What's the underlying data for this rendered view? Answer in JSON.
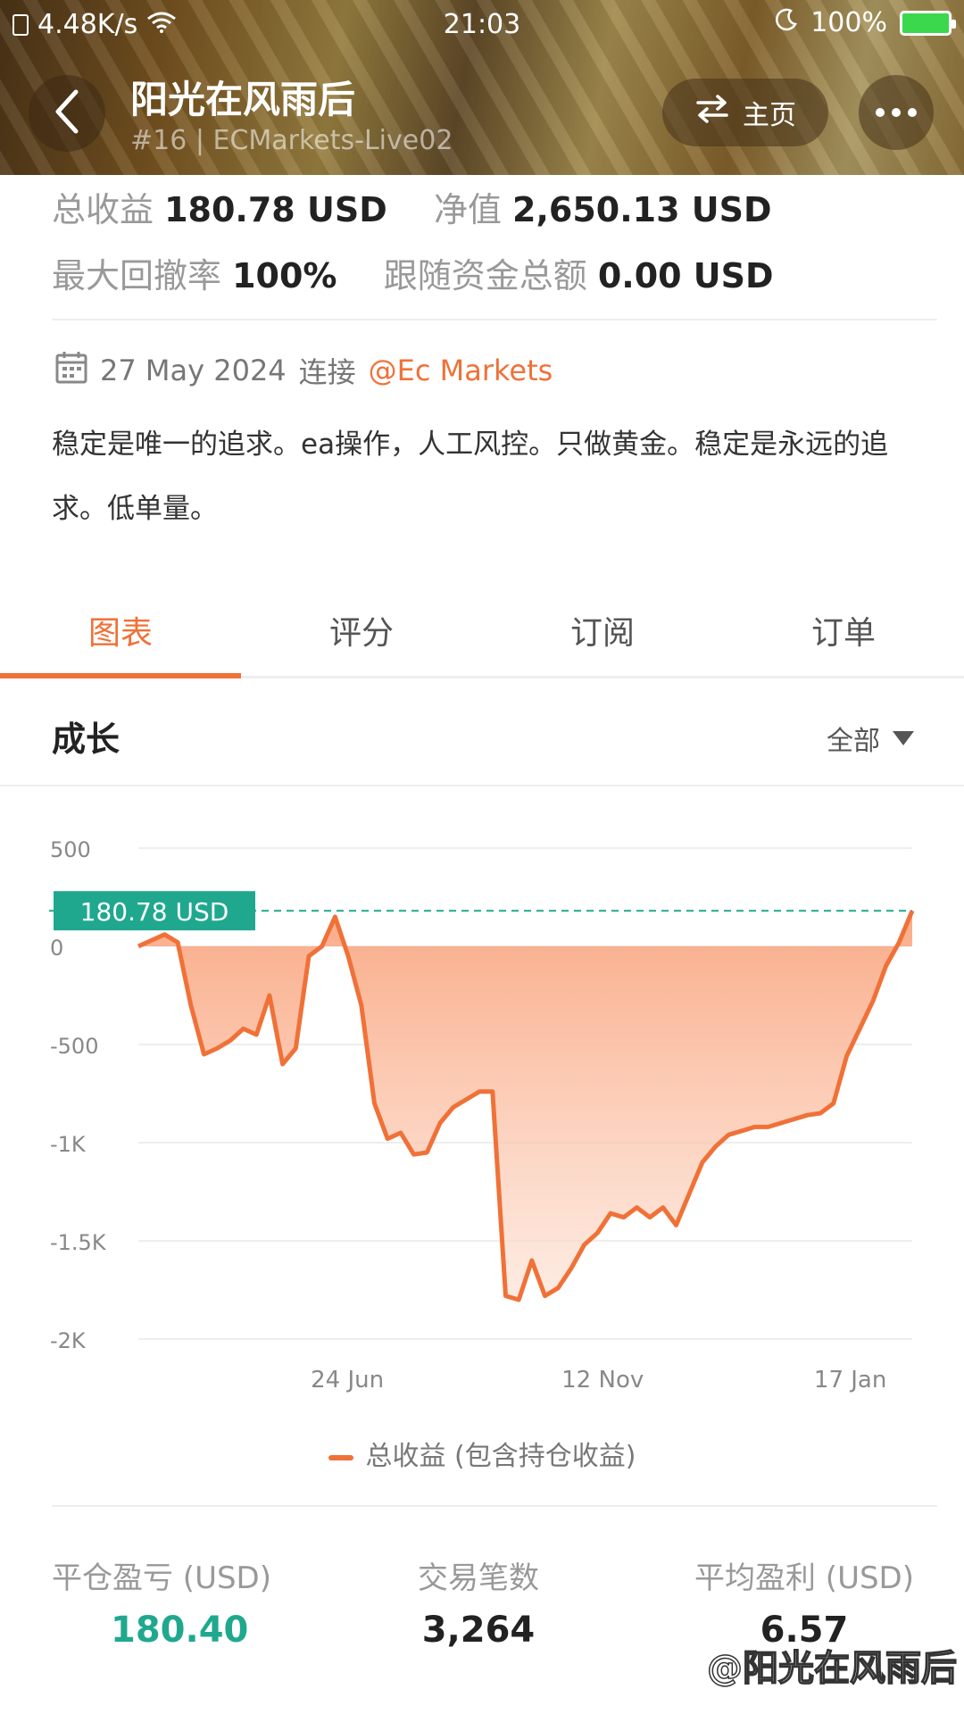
{
  "status": {
    "net_speed": "4.48K/s",
    "time": "21:03",
    "battery": "100%"
  },
  "header": {
    "title": "阳光在风雨后",
    "subtitle": "#16 | ECMarkets-Live02",
    "home_label": "主页"
  },
  "stats": {
    "total_profit_label": "总收益",
    "total_profit_value": "180.78 USD",
    "equity_label": "净值",
    "equity_value": "2,650.13 USD",
    "max_drawdown_label": "最大回撤率",
    "max_drawdown_value": "100%",
    "follower_funds_label": "跟随资金总额",
    "follower_funds_value": "0.00 USD"
  },
  "meta": {
    "date": "27 May 2024",
    "connect_label": "连接",
    "broker": "@Ec Markets"
  },
  "description": "稳定是唯一的追求。ea操作，人工风控。只做黄金。稳定是永远的追求。低单量。",
  "tabs": [
    {
      "label": "图表"
    },
    {
      "label": "评分"
    },
    {
      "label": "订阅"
    },
    {
      "label": "订单"
    }
  ],
  "section": {
    "title": "成长",
    "range": "全部"
  },
  "chart_data": {
    "type": "area",
    "y_ticks": [
      "500",
      "0",
      "-500",
      "-1K",
      "-1.5K",
      "-2K"
    ],
    "x_ticks": [
      "24 Jun",
      "12 Nov",
      "17 Jan"
    ],
    "ylim": [
      -2000,
      500
    ],
    "current_value_label": "180.78 USD",
    "current_value": 180.78,
    "series": [
      {
        "name": "总收益 (包含持仓收益)",
        "values": [
          0,
          30,
          60,
          20,
          -300,
          -550,
          -520,
          -480,
          -420,
          -450,
          -250,
          -600,
          -520,
          -50,
          0,
          150,
          -50,
          -300,
          -800,
          -980,
          -950,
          -1060,
          -1050,
          -900,
          -820,
          -780,
          -740,
          -740,
          -1780,
          -1800,
          -1600,
          -1780,
          -1740,
          -1640,
          -1520,
          -1460,
          -1360,
          -1380,
          -1330,
          -1380,
          -1330,
          -1420,
          -1260,
          -1100,
          -1020,
          -960,
          -940,
          -920,
          -920,
          -900,
          -880,
          -860,
          -850,
          -800,
          -560,
          -420,
          -280,
          -100,
          20,
          180.78
        ],
        "color": "#f07138"
      }
    ]
  },
  "metrics": [
    {
      "label": "平仓盈亏 (USD)",
      "value": "180.40",
      "color": "#20a88f"
    },
    {
      "label": "交易笔数",
      "value": "3,264"
    },
    {
      "label": "平均盈利 (USD)",
      "value": "6.57"
    }
  ],
  "watermark": "@阳光在风雨后",
  "colors": {
    "accent": "#f07138",
    "profit_green": "#20a88f"
  }
}
